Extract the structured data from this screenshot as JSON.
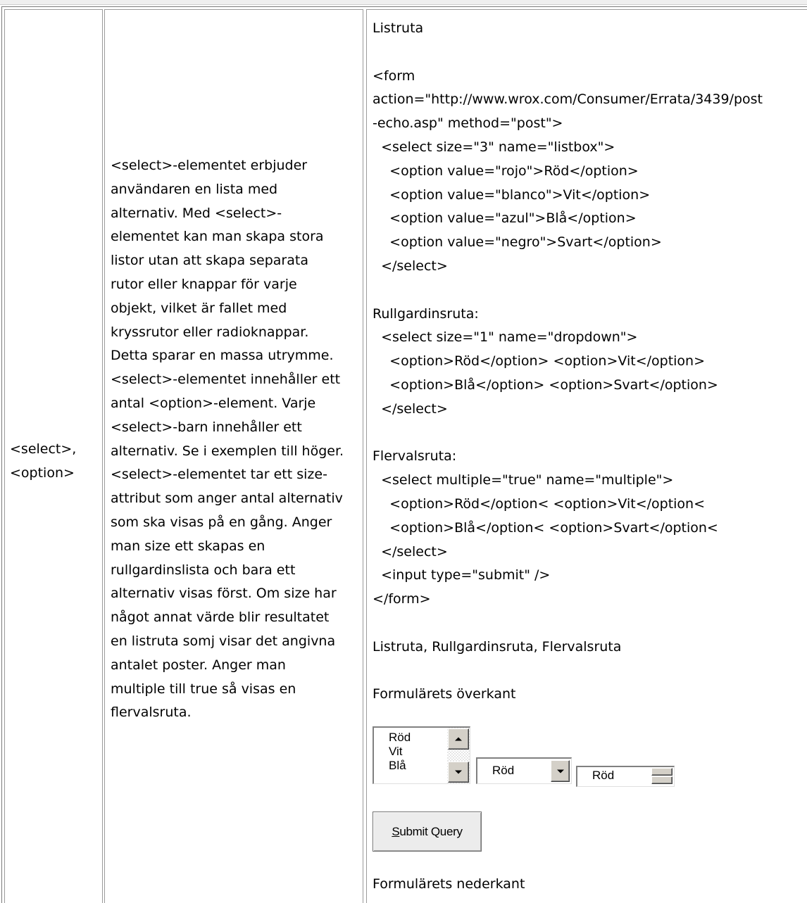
{
  "element_col": {
    "text": "<select>,\n<option>"
  },
  "description": {
    "text": "<select>-elementet erbjuder\nanvändaren en lista med\nalternativ. Med <select>-\nelementet kan man skapa stora\nlistor utan att skapa separata\nrutor eller knappar för varje\nobjekt, vilket är fallet med\nkryssrutor eller radioknappar.\nDetta sparar en massa utrymme.\n<select>-elementet innehåller ett\nantal <option>-element. Varje\n<select>-barn innehåller ett\nalternativ. Se i exemplen till höger.\n<select>-elementet tar ett size-\nattribut som anger antal alternativ\nsom ska visas på en gång. Anger\nman size ett skapas en\nrullgardinslista och bara ett\nalternativ visas först. Om size har\nnågot annat värde blir resultatet\nen listruta somj visar det angivna\nantalet poster. Anger man\nmultiple till true så visas en\nflervalsruta."
  },
  "example": {
    "lines": [
      "Listruta",
      "",
      "<form",
      "action=\"http://www.wrox.com/Consumer/Errata/3439/post",
      "-echo.asp\" method=\"post\">",
      "  <select size=\"3\" name=\"listbox\">",
      "    <option value=\"rojo\">Röd</option>",
      "    <option value=\"blanco\">Vit</option>",
      "    <option value=\"azul\">Blå</option>",
      "    <option value=\"negro\">Svart</option>",
      "  </select>",
      "",
      "Rullgardinsruta:",
      "  <select size=\"1\" name=\"dropdown\">",
      "    <option>Röd</option> <option>Vit</option>",
      "    <option>Blå</option> <option>Svart</option>",
      "  </select>",
      "",
      "Flervalsruta:",
      "  <select multiple=\"true\" name=\"multiple\">",
      "    <option>Röd</option< <option>Vit</option<",
      "    <option>Blå</option< <option>Svart</option<",
      "  </select>",
      "  <input type=\"submit\" />",
      "</form>",
      "",
      "Listruta, Rullgardinsruta, Flervalsruta",
      "",
      "Formulärets överkant"
    ],
    "footer": "Formulärets nederkant"
  },
  "controls": {
    "listbox_options": [
      "Röd",
      "Vit",
      "Blå"
    ],
    "dropdown_value": "Röd",
    "multiple_value": "Röd",
    "submit_access_key": "S",
    "submit_rest": "ubmit Query"
  }
}
